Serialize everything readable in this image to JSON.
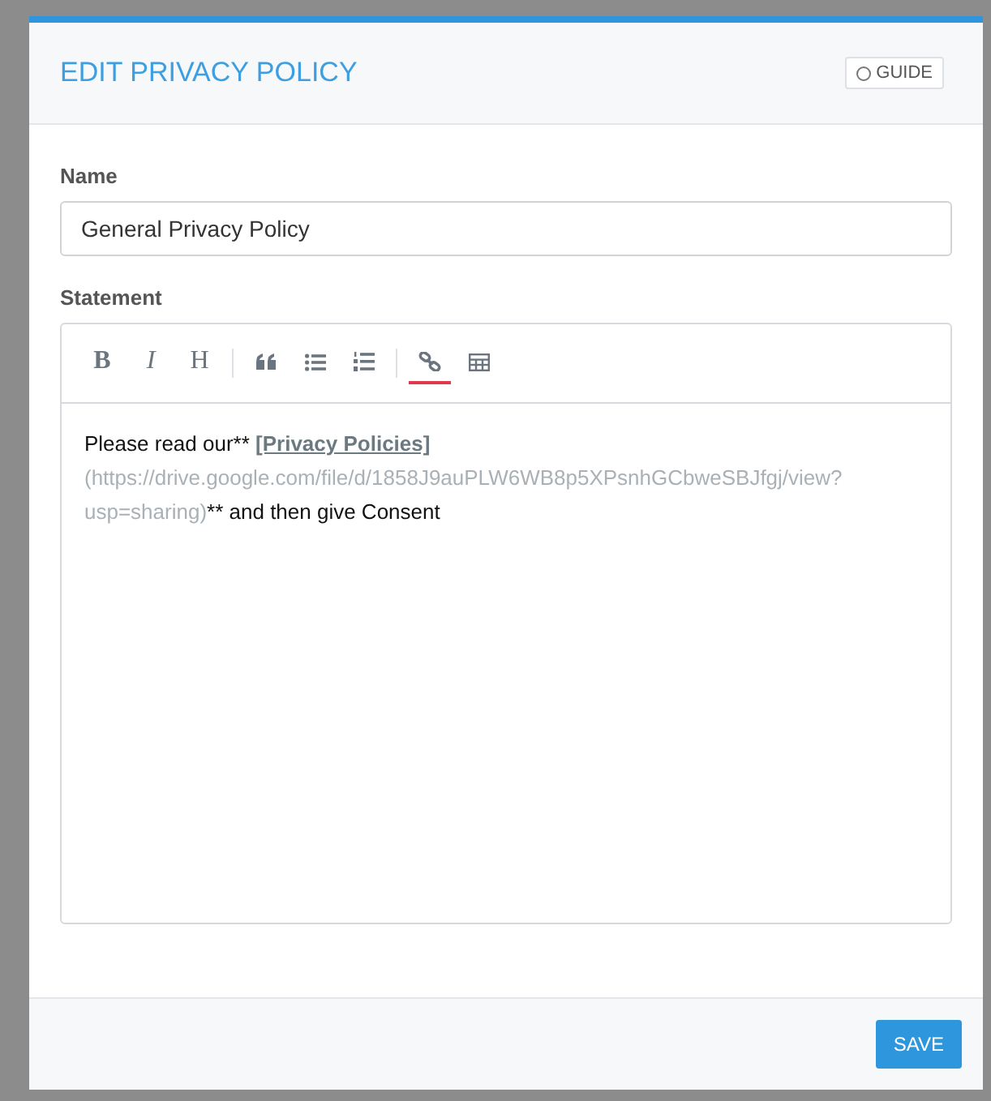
{
  "modal": {
    "title": "EDIT PRIVACY POLICY",
    "guide_button": "GUIDE"
  },
  "fields": [
    {
      "label": "Name",
      "value": "General Privacy Policy"
    }
  ],
  "statement": {
    "label": "Statement",
    "toolbar": [
      {
        "kind": "bold",
        "label": "B",
        "active": false
      },
      {
        "kind": "italic",
        "label": "I",
        "active": false
      },
      {
        "kind": "heading",
        "label": "H",
        "active": false
      },
      {
        "kind": "separator"
      },
      {
        "kind": "quote",
        "active": false
      },
      {
        "kind": "bullet-list",
        "active": false
      },
      {
        "kind": "numbered-list",
        "active": false
      },
      {
        "kind": "separator"
      },
      {
        "kind": "link",
        "active": true
      },
      {
        "kind": "table",
        "active": false
      }
    ],
    "content": [
      {
        "kind": "plain",
        "text": "Please read our**"
      },
      {
        "kind": "link",
        "text": "[Privacy Policies]"
      },
      {
        "kind": "url",
        "text": "(https://drive.google.com/file/d/1858J9auPLW6WB8p5XPsnhGCbweSBJfgj/view?usp=sharing)"
      },
      {
        "kind": "plain",
        "text": "** and then give Consent"
      }
    ]
  },
  "footer": {
    "save_button": "SAVE"
  }
}
